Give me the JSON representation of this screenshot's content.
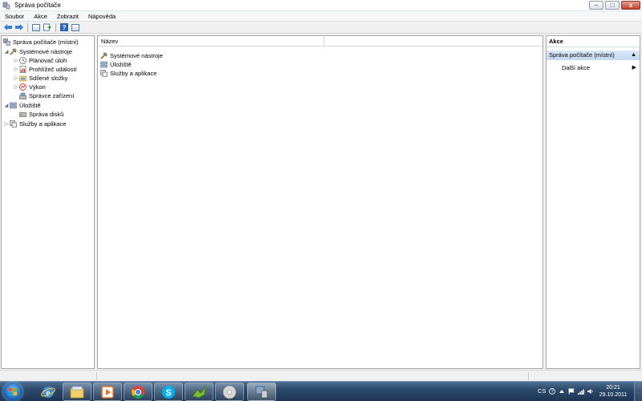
{
  "window": {
    "title": "Správa počítače",
    "controls": {
      "minimize": "–",
      "maximize": "□",
      "close": "x"
    }
  },
  "menu": [
    "Soubor",
    "Akce",
    "Zobrazit",
    "Nápověda"
  ],
  "tree": {
    "root": "Správa počítače (místní)",
    "system_tools": "Systémové nástroje",
    "task_scheduler": "Plánovač úloh",
    "event_viewer": "Prohlížeč událostí",
    "shared_folders": "Sdílené složky",
    "performance": "Výkon",
    "device_manager": "Správce zařízení",
    "storage": "Úložiště",
    "disk_management": "Správa disků",
    "services_apps": "Služby a aplikace"
  },
  "list": {
    "column_name": "Název",
    "items": [
      "Systémové nástroje",
      "Úložiště",
      "Služby a aplikace"
    ]
  },
  "actions": {
    "header": "Akce",
    "group": "Správa počítače (místní)",
    "more": "Další akce"
  },
  "taskbar": {
    "lang": "CS",
    "time": "20:21",
    "date": "29.10.2011"
  }
}
